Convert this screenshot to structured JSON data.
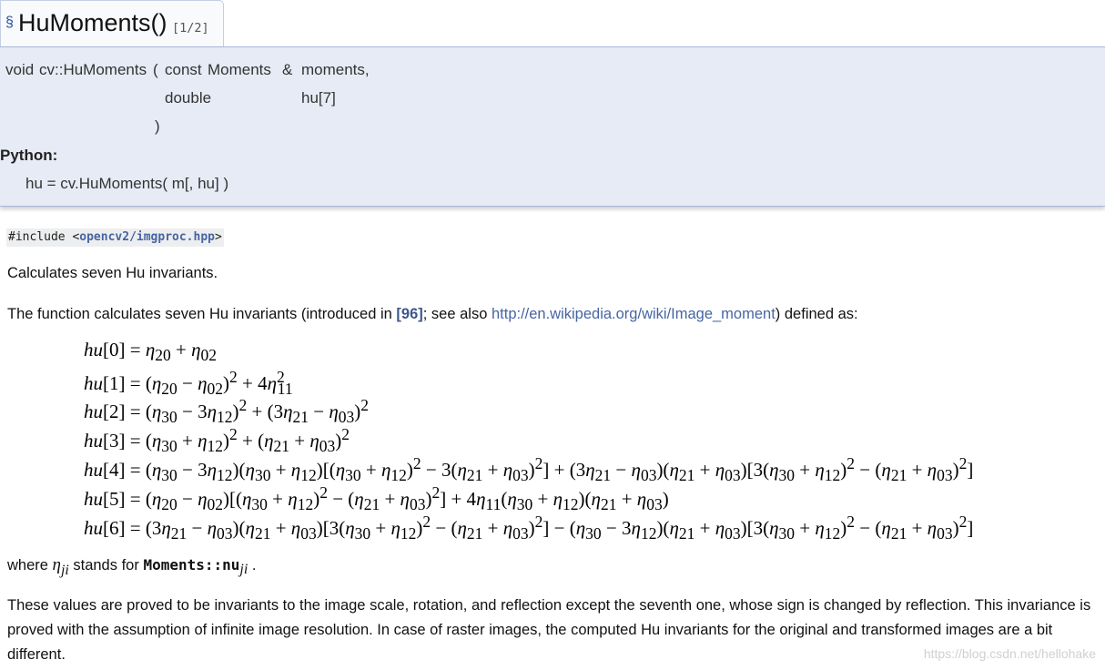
{
  "header": {
    "section_symbol": "§",
    "title": "HuMoments()",
    "overload": "[1/2]"
  },
  "prototype": {
    "return_type": "void",
    "func": "cv::HuMoments",
    "open_paren": "(",
    "const_kw": "const",
    "param1_type": "Moments",
    "param1_ref": "&",
    "param1_name": "moments,",
    "param2_type": "double",
    "param2_name": "hu[7]",
    "close_paren": ")",
    "python_label": "Python:",
    "python_sig": "hu = cv.HuMoments( m[, hu] )"
  },
  "include": {
    "prefix": "#include <",
    "file": "opencv2/imgproc.hpp",
    "suffix": ">"
  },
  "brief": "Calculates seven Hu invariants.",
  "description": {
    "before": "The function calculates seven Hu invariants (introduced in ",
    "ref": "[96]",
    "middle": "; see also ",
    "link": "http://en.wikipedia.org/wiki/Image_moment",
    "after": ") defined as:"
  },
  "equations": [
    "hu[0] = η₂₀ + η₀₂",
    "hu[1] = (η₂₀ − η₀₂)² + 4η₁₁²",
    "hu[2] = (η₃₀ − 3η₁₂)² + (3η₂₁ − η₀₃)²",
    "hu[3] = (η₃₀ + η₁₂)² + (η₂₁ + η₀₃)²",
    "hu[4] = (η₃₀ − 3η₁₂)(η₃₀ + η₁₂)[(η₃₀ + η₁₂)² − 3(η₂₁ + η₀₃)²] + (3η₂₁ − η₀₃)(η₂₁ + η₀₃)[3(η₃₀ + η₁₂)² − (η₂₁ + η₀₃)²]",
    "hu[5] = (η₂₀ − η₀₂)[(η₃₀ + η₁₂)² − (η₂₁ + η₀₃)²] + 4η₁₁(η₃₀ + η₁₂)(η₂₁ + η₀₃)",
    "hu[6] = (3η₂₁ − η₀₃)(η₂₁ + η₀₃)[3(η₃₀ + η₁₂)² − (η₂₁ + η₀₃)²] − (η₃₀ − 3η₁₂)(η₂₁ + η₀₃)[3(η₃₀ + η₁₂)² − (η₂₁ + η₀₃)²]"
  ],
  "where": {
    "before": "where",
    "symbol": "η",
    "symbol_sub": "ji",
    "middle": "stands for",
    "code": "Moments::nu",
    "code_sub": "ji",
    "after": "."
  },
  "paragraph": "These values are proved to be invariants to the image scale, rotation, and reflection except the seventh one, whose sign is changed by reflection. This invariance is proved with the assumption of infinite image resolution. In case of raster images, the computed Hu invariants for the original and transformed images are a bit different.",
  "watermark": "https://blog.csdn.net/hellohake"
}
